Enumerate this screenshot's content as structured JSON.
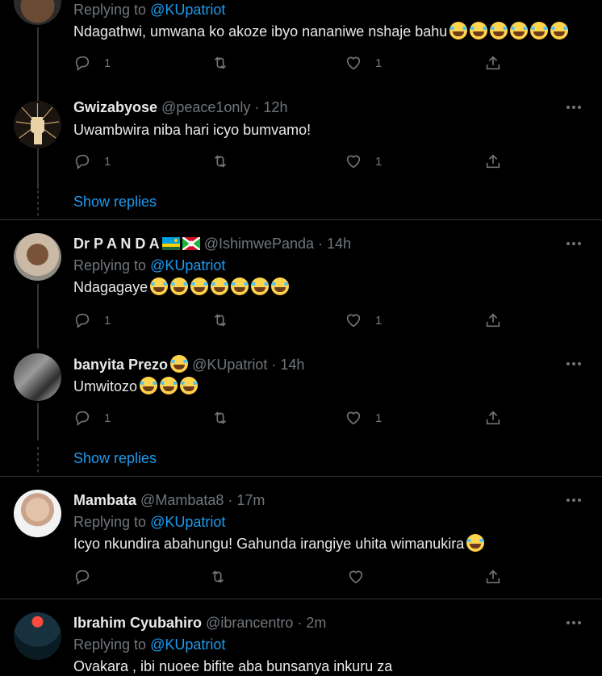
{
  "tweets": [
    {
      "id": "t1",
      "replying_prefix": "Replying to ",
      "replying_to": "@KUpatriot",
      "text": "Ndagathwi, umwana ko akoze ibyo nananiwe nshaje bahu",
      "emoji_count": 6,
      "reply_count": "1",
      "like_count": "1"
    },
    {
      "id": "t2",
      "name": "Gwizabyose",
      "handle": "@peace1only",
      "time": "12h",
      "text": "Uwambwira niba hari icyo bumvamo!",
      "reply_count": "1",
      "like_count": "1",
      "avatar_icon": "raised-fist-icon"
    },
    {
      "id": "t3",
      "name": "Dr P A N D A",
      "handle": "@IshimwePanda",
      "time": "14h",
      "replying_prefix": "Replying to ",
      "replying_to": "@KUpatriot",
      "text": "Ndagagaye",
      "emoji_count": 7,
      "reply_count": "1",
      "like_count": "1"
    },
    {
      "id": "t4",
      "name": "banyita Prezo",
      "handle": "@KUpatriot",
      "time": "14h",
      "text": "Umwitozo",
      "emoji_count": 3,
      "reply_count": "1",
      "like_count": "1"
    },
    {
      "id": "t5",
      "name": "Mambata",
      "handle": "@Mambata8",
      "time": "17m",
      "replying_prefix": "Replying to ",
      "replying_to": "@KUpatriot",
      "text": "Icyo nkundira abahungu! Gahunda irangiye uhita wimanukira",
      "emoji_count": 1,
      "reply_count": "",
      "like_count": ""
    },
    {
      "id": "t6",
      "name": "Ibrahim Cyubahiro",
      "handle": "@ibrancentro",
      "time": "2m",
      "replying_prefix": "Replying to ",
      "replying_to": "@KUpatriot",
      "text": "Ovakara , ibi nuoee bifite aba bunsanya inkuru za"
    }
  ],
  "show_replies_label": "Show replies",
  "separator": " · ",
  "colors": {
    "background": "#000000",
    "text": "#e7e9ea",
    "muted": "#71767b",
    "accent": "#1d9bf0",
    "divider": "#2f3336"
  }
}
